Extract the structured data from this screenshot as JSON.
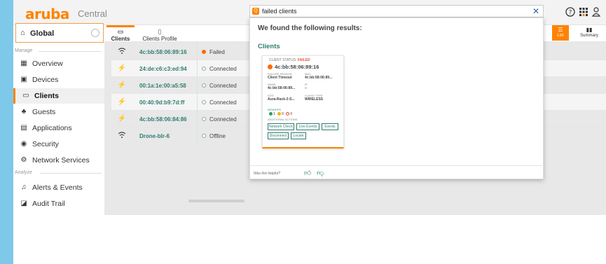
{
  "brand": {
    "logo": "aruba",
    "product": "Central",
    "color": "#ff8300"
  },
  "topbar": {
    "icons": [
      "help-icon",
      "apps-grid-icon",
      "user-icon"
    ]
  },
  "scope": {
    "label": "Global"
  },
  "sidebar": {
    "sections": [
      {
        "label": "Manage"
      },
      {
        "label": "Analyze"
      }
    ],
    "items": [
      {
        "label": "Overview",
        "icon": "overview-icon"
      },
      {
        "label": "Devices",
        "icon": "devices-icon"
      },
      {
        "label": "Clients",
        "icon": "clients-icon",
        "active": true
      },
      {
        "label": "Guests",
        "icon": "guests-icon"
      },
      {
        "label": "Applications",
        "icon": "applications-icon"
      },
      {
        "label": "Security",
        "icon": "security-icon"
      },
      {
        "label": "Network Services",
        "icon": "network-services-icon"
      },
      {
        "label": "Alerts & Events",
        "icon": "alerts-icon"
      },
      {
        "label": "Audit Trail",
        "icon": "audit-trail-icon"
      }
    ]
  },
  "tabs": [
    {
      "label": "Clients",
      "active": true
    },
    {
      "label": "Clients Profile"
    }
  ],
  "view": {
    "list_label": "List",
    "summary_label": "Summary"
  },
  "clients": [
    {
      "mac": "4c:bb:58:06:89:16",
      "status": "Failed",
      "type": "wireless"
    },
    {
      "mac": "24:de:c6:c3:ed:94",
      "status": "Connected",
      "type": "wired"
    },
    {
      "mac": "00:1a:1e:00:a5:58",
      "status": "Connected",
      "type": "wired"
    },
    {
      "mac": "00:40:9d:b9:7d:ff",
      "status": "Connected",
      "type": "wired"
    },
    {
      "mac": "4c:bb:58:06:84:86",
      "status": "Connected",
      "type": "wired"
    },
    {
      "mac": "Drone-blr-6",
      "status": "Offline",
      "type": "wireless"
    }
  ],
  "status_colors": {
    "Failed": "#ff6a00",
    "Connected": "#ffffff",
    "Offline": "#ffffff"
  },
  "search": {
    "query": "failed clients",
    "heading": "We found the following results:",
    "section": "Clients",
    "card": {
      "status_label": "CLIENT STATUS:",
      "status_value": "FAILED",
      "mac": "4c:bb:58:06:89:16",
      "fields": [
        {
          "label": "FAILURE REASON",
          "value": "Client Timeout"
        },
        {
          "label": "MAC",
          "value": "4c:bb:58:06:89..."
        },
        {
          "label": "NAME",
          "value": "4c:bb:58:06:89..."
        },
        {
          "label": "IP",
          "value": "--"
        },
        {
          "label": "SITE",
          "value": "Aura-Rack-2-S..."
        },
        {
          "label": "CLIENT TYPE",
          "value": "WIRELESS"
        }
      ],
      "insights_label": "INSIGHTS",
      "insights": [
        {
          "count": "1",
          "color": "#2e9e5b"
        },
        {
          "count": "0",
          "color": "#f5b700"
        },
        {
          "count": "0",
          "color": "#e8512d"
        }
      ],
      "actions_label": "ADDITIONAL ACTIONS",
      "actions": [
        "Network Check",
        "Live Events",
        "Events",
        "Disconnect",
        "Locate"
      ]
    },
    "helpful_label": "Was this helpful?"
  }
}
